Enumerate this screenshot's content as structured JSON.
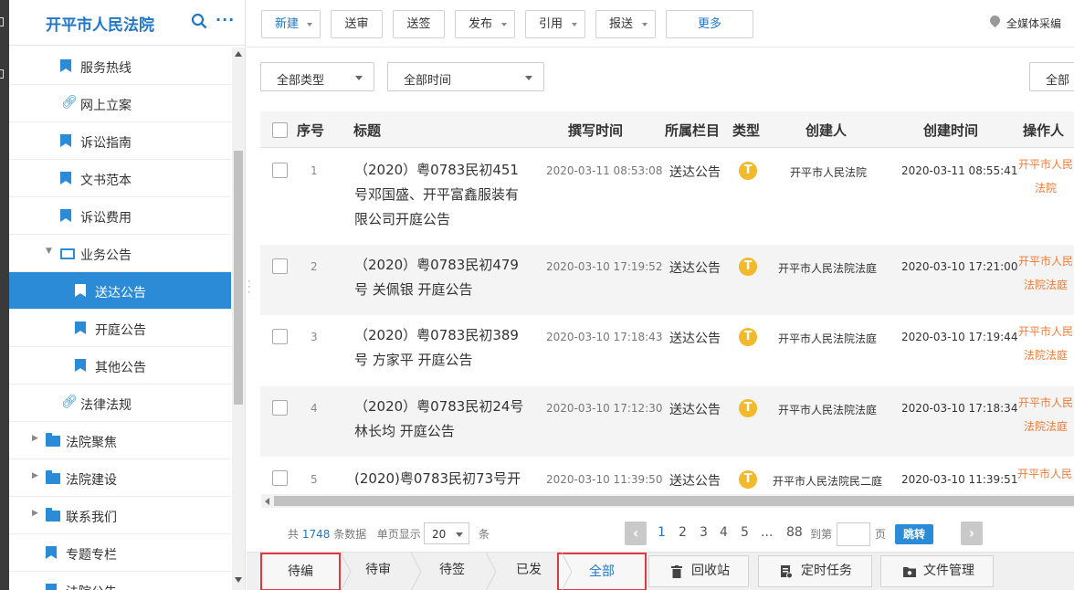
{
  "sidebar": {
    "title": "开平市人民法院",
    "more": "···",
    "items": [
      {
        "label": "服务热线",
        "icon": "bookmark-icon"
      },
      {
        "label": "网上立案",
        "icon": "link-icon"
      },
      {
        "label": "诉讼指南",
        "icon": "bookmark-icon"
      },
      {
        "label": "文书范本",
        "icon": "bookmark-icon"
      },
      {
        "label": "诉讼费用",
        "icon": "bookmark-icon"
      },
      {
        "label": "业务公告",
        "icon": "folder-open-icon"
      },
      {
        "label": "送达公告",
        "icon": "bookmark-icon"
      },
      {
        "label": "开庭公告",
        "icon": "bookmark-icon"
      },
      {
        "label": "其他公告",
        "icon": "bookmark-icon"
      },
      {
        "label": "法律法规",
        "icon": "link-icon"
      },
      {
        "label": "法院聚焦",
        "icon": "folder-icon"
      },
      {
        "label": "法院建设",
        "icon": "folder-icon"
      },
      {
        "label": "联系我们",
        "icon": "folder-icon"
      },
      {
        "label": "专题专栏",
        "icon": "bookmark-icon"
      },
      {
        "label": "法院公告",
        "icon": "bookmark-icon"
      }
    ]
  },
  "toolbar": {
    "new": "新建",
    "review": "送审",
    "sign": "送签",
    "publish": "发布",
    "cite": "引用",
    "report": "报送",
    "more": "更多",
    "location": "全媒体采编"
  },
  "filters": {
    "type": "全部类型",
    "time": "全部时间",
    "right": "全部"
  },
  "table": {
    "headers": {
      "num": "序号",
      "title": "标题",
      "write_time": "撰写时间",
      "column": "所属栏目",
      "type": "类型",
      "creator": "创建人",
      "create_time": "创建时间",
      "operator": "操作人"
    },
    "rows": [
      {
        "num": "1",
        "title": "（2020）粤0783民初451号邓国盛、开平富鑫服装有限公司开庭公告",
        "write_time": "2020-03-11 08:53:08",
        "column": "送达公告",
        "type": "T",
        "creator": "开平市人民法院",
        "create_time": "2020-03-11 08:55:41",
        "operator": "开平市人民法院"
      },
      {
        "num": "2",
        "title": "（2020）粤0783民初479号 关佩银 开庭公告",
        "write_time": "2020-03-10 17:19:52",
        "column": "送达公告",
        "type": "T",
        "creator": "开平市人民法院法庭",
        "create_time": "2020-03-10 17:21:00",
        "operator": "开平市人民法院法庭"
      },
      {
        "num": "3",
        "title": "（2020）粤0783民初389号 方家平 开庭公告",
        "write_time": "2020-03-10 17:18:43",
        "column": "送达公告",
        "type": "T",
        "creator": "开平市人民法院法庭",
        "create_time": "2020-03-10 17:19:44",
        "operator": "开平市人民法院法庭"
      },
      {
        "num": "4",
        "title": "（2020）粤0783民初24号 林长均 开庭公告",
        "write_time": "2020-03-10 17:12:30",
        "column": "送达公告",
        "type": "T",
        "creator": "开平市人民法院法庭",
        "create_time": "2020-03-10 17:18:34",
        "operator": "开平市人民法院法庭"
      },
      {
        "num": "5",
        "title": "(2020)粤0783民初73号开",
        "write_time": "2020-03-10 11:39:50",
        "column": "送达公告",
        "type": "T",
        "creator": "开平市人民法院民二庭",
        "create_time": "2020-03-10 11:39:51",
        "operator": "开平市人民"
      }
    ]
  },
  "pager": {
    "total_prefix": "共",
    "total": "1748",
    "total_suffix": "条数据",
    "page_size_label": "单页显示",
    "page_size": "20",
    "page_size_suffix": "条",
    "pages": [
      "1",
      "2",
      "3",
      "4",
      "5",
      "...",
      "88"
    ],
    "goto_label": "到第",
    "page_unit": "页",
    "goto_button": "跳转"
  },
  "tabs": {
    "draft": "待编",
    "review": "待审",
    "sign": "待签",
    "published": "已发",
    "all": "全部",
    "recycle": "回收站",
    "scheduled": "定时任务",
    "files": "文件管理"
  }
}
